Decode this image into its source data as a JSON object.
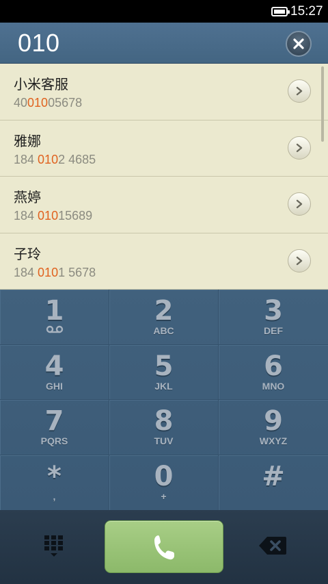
{
  "status_bar": {
    "time": "15:27",
    "battery_icon": "battery-icon"
  },
  "header": {
    "dialed_number": "010",
    "clear_icon": "close-icon"
  },
  "contacts": [
    {
      "name": "小米客服",
      "number_pre": "40",
      "number_match": "010",
      "number_post": "05678"
    },
    {
      "name": "雅娜",
      "number_pre": "184 ",
      "number_match": "010",
      "number_post": "2 4685"
    },
    {
      "name": "燕婷",
      "number_pre": "184 ",
      "number_match": "010",
      "number_post": "15689"
    },
    {
      "name": "子玲",
      "number_pre": "184 ",
      "number_match": "010",
      "number_post": "1 5678"
    }
  ],
  "keypad": [
    {
      "digit": "1",
      "letters": ""
    },
    {
      "digit": "2",
      "letters": "ABC"
    },
    {
      "digit": "3",
      "letters": "DEF"
    },
    {
      "digit": "4",
      "letters": "GHI"
    },
    {
      "digit": "5",
      "letters": "JKL"
    },
    {
      "digit": "6",
      "letters": "MNO"
    },
    {
      "digit": "7",
      "letters": "PQRS"
    },
    {
      "digit": "8",
      "letters": "TUV"
    },
    {
      "digit": "9",
      "letters": "WXYZ"
    },
    {
      "digit": "*",
      "letters": ","
    },
    {
      "digit": "0",
      "letters": "+"
    },
    {
      "digit": "#",
      "letters": ""
    }
  ],
  "bottom_bar": {
    "dialpad_icon": "dialpad-grid-icon",
    "call_icon": "phone-icon",
    "backspace_icon": "backspace-icon"
  },
  "colors": {
    "match_highlight": "#e0621f",
    "header": "#4a6b8a",
    "list_bg": "#ebe9cf",
    "call_button": "#9cc57a",
    "keypad": "#3e5d79"
  }
}
